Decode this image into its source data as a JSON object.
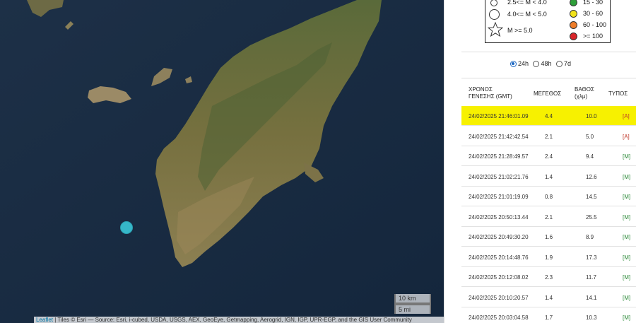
{
  "map": {
    "attribution_link": "Leaflet",
    "attribution_text": " | Tiles © Esri — Source: Esri, i-cubed, USDA, USGS, AEX, GeoEye, Getmapping, Aerogrid, IGN, IGP, UPR-EGP, and the GIS User Community",
    "scale_km": "10 km",
    "scale_mi": "5 mi",
    "marker_color": "#36b7c9"
  },
  "legend": {
    "magnitude_rows": [
      "2.5<= M < 4.0",
      "4.0<= M < 5.0",
      "M >= 5.0"
    ],
    "depth_rows": [
      {
        "label": "15 - 30",
        "color": "#2e9e3a"
      },
      {
        "label": "30 - 60",
        "color": "#f1e21b"
      },
      {
        "label": "60 - 100",
        "color": "#ee7d2a"
      },
      {
        "label": ">= 100",
        "color": "#d8262a"
      }
    ]
  },
  "time_range": {
    "options": [
      "24h",
      "48h",
      "7d"
    ],
    "selected": "24h"
  },
  "table": {
    "headers": {
      "time_line1": "ΧΡΟΝΟΣ",
      "time_line2": "ΓΕΝΕΣΗΣ (GMT)",
      "magnitude": "ΜΕΓΕΘΟΣ",
      "depth_line1": "ΒΑΘΟΣ",
      "depth_line2": "(χλμ)",
      "type": "ΤΥΠΟΣ"
    },
    "highlight_color": "#f7f100",
    "rows": [
      {
        "time": "24/02/2025 21:46:01.09",
        "mag": "4.4",
        "depth": "10.0",
        "type": "[A]"
      },
      {
        "time": "24/02/2025 21:42:42.54",
        "mag": "2.1",
        "depth": "5.0",
        "type": "[A]"
      },
      {
        "time": "24/02/2025 21:28:49.57",
        "mag": "2.4",
        "depth": "9.4",
        "type": "[M]"
      },
      {
        "time": "24/02/2025 21:02:21.76",
        "mag": "1.4",
        "depth": "12.6",
        "type": "[M]"
      },
      {
        "time": "24/02/2025 21:01:19.09",
        "mag": "0.8",
        "depth": "14.5",
        "type": "[M]"
      },
      {
        "time": "24/02/2025 20:50:13.44",
        "mag": "2.1",
        "depth": "25.5",
        "type": "[M]"
      },
      {
        "time": "24/02/2025 20:49:30.20",
        "mag": "1.6",
        "depth": "8.9",
        "type": "[M]"
      },
      {
        "time": "24/02/2025 20:14:48.76",
        "mag": "1.9",
        "depth": "17.3",
        "type": "[M]"
      },
      {
        "time": "24/02/2025 20:12:08.02",
        "mag": "2.3",
        "depth": "11.7",
        "type": "[M]"
      },
      {
        "time": "24/02/2025 20:10:20.57",
        "mag": "1.4",
        "depth": "14.1",
        "type": "[M]"
      },
      {
        "time": "24/02/2025 20:03:04.58",
        "mag": "1.7",
        "depth": "10.3",
        "type": "[M]"
      }
    ]
  }
}
